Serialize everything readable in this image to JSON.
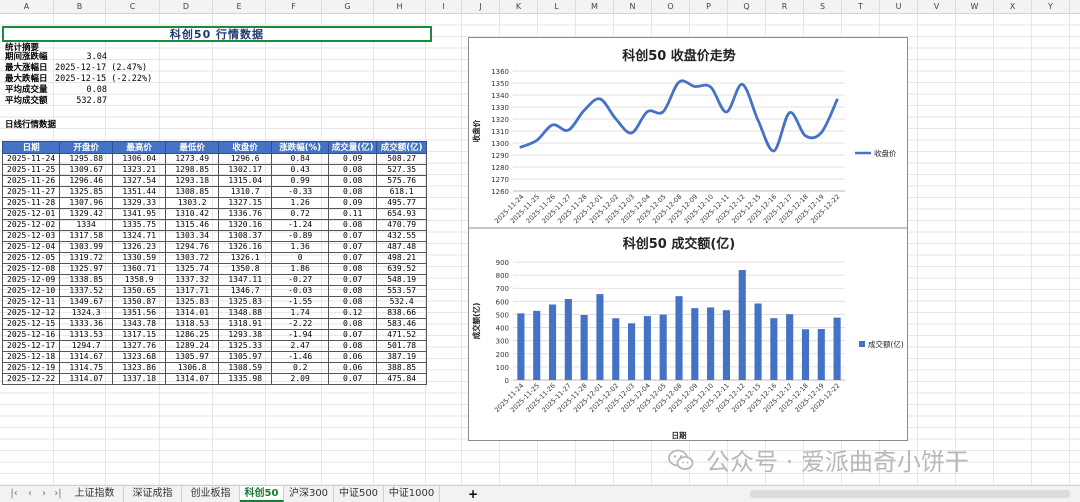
{
  "columns": [
    "A",
    "B",
    "C",
    "D",
    "E",
    "F",
    "G",
    "H",
    "I",
    "J",
    "K",
    "L",
    "M",
    "N",
    "O",
    "P",
    "Q",
    "R",
    "S",
    "T",
    "U",
    "V",
    "W",
    "X",
    "Y"
  ],
  "sheet_title": "科创50  行情数据",
  "stats_header": "统计摘要",
  "stats": [
    {
      "label": "期间涨跌幅",
      "value": "3.04"
    },
    {
      "label": "最大涨幅日",
      "value": "2025-12-17 (2.47%)"
    },
    {
      "label": "最大跌幅日",
      "value": "2025-12-15 (-2.22%)"
    },
    {
      "label": "平均成交量",
      "value": "0.08"
    },
    {
      "label": "平均成交额",
      "value": "532.87"
    }
  ],
  "daily_header": "日线行情数据",
  "table": {
    "headers": [
      "日期",
      "开盘价",
      "最高价",
      "最低价",
      "收盘价",
      "涨跌幅(%)",
      "成交量(亿)",
      "成交额(亿)"
    ],
    "rows": [
      [
        "2025-11-24",
        "1295.88",
        "1306.04",
        "1273.49",
        "1296.6",
        "0.84",
        "0.09",
        "508.27"
      ],
      [
        "2025-11-25",
        "1309.67",
        "1323.21",
        "1298.85",
        "1302.17",
        "0.43",
        "0.08",
        "527.35"
      ],
      [
        "2025-11-26",
        "1296.46",
        "1327.54",
        "1293.18",
        "1315.04",
        "0.99",
        "0.08",
        "575.76"
      ],
      [
        "2025-11-27",
        "1325.85",
        "1351.44",
        "1308.85",
        "1310.7",
        "-0.33",
        "0.08",
        "618.1"
      ],
      [
        "2025-11-28",
        "1307.96",
        "1329.33",
        "1303.2",
        "1327.15",
        "1.26",
        "0.09",
        "495.77"
      ],
      [
        "2025-12-01",
        "1329.42",
        "1341.95",
        "1310.42",
        "1336.76",
        "0.72",
        "0.11",
        "654.93"
      ],
      [
        "2025-12-02",
        "1334",
        "1335.75",
        "1315.46",
        "1320.16",
        "-1.24",
        "0.08",
        "470.79"
      ],
      [
        "2025-12-03",
        "1317.58",
        "1324.71",
        "1303.34",
        "1308.37",
        "-0.89",
        "0.07",
        "432.55"
      ],
      [
        "2025-12-04",
        "1303.99",
        "1326.23",
        "1294.76",
        "1326.16",
        "1.36",
        "0.07",
        "487.48"
      ],
      [
        "2025-12-05",
        "1319.72",
        "1330.59",
        "1303.72",
        "1326.1",
        "0",
        "0.07",
        "498.21"
      ],
      [
        "2025-12-08",
        "1325.97",
        "1360.71",
        "1325.74",
        "1350.8",
        "1.86",
        "0.08",
        "639.52"
      ],
      [
        "2025-12-09",
        "1338.85",
        "1358.9",
        "1337.32",
        "1347.11",
        "-0.27",
        "0.07",
        "548.19"
      ],
      [
        "2025-12-10",
        "1337.52",
        "1350.65",
        "1317.71",
        "1346.7",
        "-0.03",
        "0.08",
        "553.57"
      ],
      [
        "2025-12-11",
        "1349.67",
        "1350.87",
        "1325.83",
        "1325.83",
        "-1.55",
        "0.08",
        "532.4"
      ],
      [
        "2025-12-12",
        "1324.3",
        "1351.56",
        "1314.01",
        "1348.88",
        "1.74",
        "0.12",
        "838.66"
      ],
      [
        "2025-12-15",
        "1333.36",
        "1343.78",
        "1318.53",
        "1318.91",
        "-2.22",
        "0.08",
        "583.46"
      ],
      [
        "2025-12-16",
        "1313.53",
        "1317.15",
        "1286.25",
        "1293.38",
        "-1.94",
        "0.07",
        "471.52"
      ],
      [
        "2025-12-17",
        "1294.7",
        "1327.76",
        "1289.24",
        "1325.33",
        "2.47",
        "0.08",
        "501.78"
      ],
      [
        "2025-12-18",
        "1314.67",
        "1323.68",
        "1305.97",
        "1305.97",
        "-1.46",
        "0.06",
        "387.19"
      ],
      [
        "2025-12-19",
        "1314.75",
        "1323.86",
        "1306.8",
        "1308.59",
        "0.2",
        "0.06",
        "388.85"
      ],
      [
        "2025-12-22",
        "1314.07",
        "1337.18",
        "1314.07",
        "1335.98",
        "2.09",
        "0.07",
        "475.84"
      ]
    ]
  },
  "chart_data": [
    {
      "type": "line",
      "title": "科创50 收盘价走势",
      "ylabel": "收盘价",
      "xlabel": "",
      "ylim": [
        1260,
        1360
      ],
      "yticks": [
        "1260",
        "1270",
        "1280",
        "1290",
        "1300",
        "1310",
        "1320",
        "1330",
        "1340",
        "1350",
        "1360"
      ],
      "grid": true,
      "legend": "right",
      "categories": [
        "2025-11-24",
        "2025-11-25",
        "2025-11-26",
        "2025-11-27",
        "2025-11-28",
        "2025-12-01",
        "2025-12-02",
        "2025-12-03",
        "2025-12-04",
        "2025-12-05",
        "2025-12-08",
        "2025-12-09",
        "2025-12-10",
        "2025-12-11",
        "2025-12-12",
        "2025-12-15",
        "2025-12-16",
        "2025-12-17",
        "2025-12-18",
        "2025-12-19",
        "2025-12-22"
      ],
      "series": [
        {
          "name": "收盘价",
          "values": [
            1296.6,
            1302.17,
            1315.04,
            1310.7,
            1327.15,
            1336.76,
            1320.16,
            1308.37,
            1326.16,
            1326.1,
            1350.8,
            1347.11,
            1346.7,
            1325.83,
            1348.88,
            1318.91,
            1293.38,
            1325.33,
            1305.97,
            1308.59,
            1335.98
          ],
          "color": "#4472c4"
        }
      ]
    },
    {
      "type": "bar",
      "title": "科创50 成交额(亿)",
      "ylabel": "成交额(亿)",
      "xlabel": "日期",
      "ylim": [
        0,
        900
      ],
      "yticks": [
        "0",
        "100",
        "200",
        "300",
        "400",
        "500",
        "600",
        "700",
        "800",
        "900"
      ],
      "grid": true,
      "legend": "right",
      "categories": [
        "2025-11-24",
        "2025-11-25",
        "2025-11-26",
        "2025-11-27",
        "2025-11-28",
        "2025-12-01",
        "2025-12-02",
        "2025-12-03",
        "2025-12-04",
        "2025-12-05",
        "2025-12-08",
        "2025-12-09",
        "2025-12-10",
        "2025-12-11",
        "2025-12-12",
        "2025-12-15",
        "2025-12-16",
        "2025-12-17",
        "2025-12-18",
        "2025-12-19",
        "2025-12-22"
      ],
      "series": [
        {
          "name": "成交额(亿)",
          "values": [
            508.27,
            527.35,
            575.76,
            618.1,
            495.77,
            654.93,
            470.79,
            432.55,
            487.48,
            498.21,
            639.52,
            548.19,
            553.57,
            532.4,
            838.66,
            583.46,
            471.52,
            501.78,
            387.19,
            388.85,
            475.84
          ],
          "color": "#4472c4"
        }
      ]
    }
  ],
  "watermark": "公众号 · 爱派曲奇小饼干",
  "watermark_icon": "wechat-icon",
  "tabs": [
    "上证指数",
    "深证成指",
    "创业板指",
    "科创50",
    "沪深300",
    "中证500",
    "中证1000"
  ],
  "active_tab": "科创50",
  "add_tab_label": "+"
}
